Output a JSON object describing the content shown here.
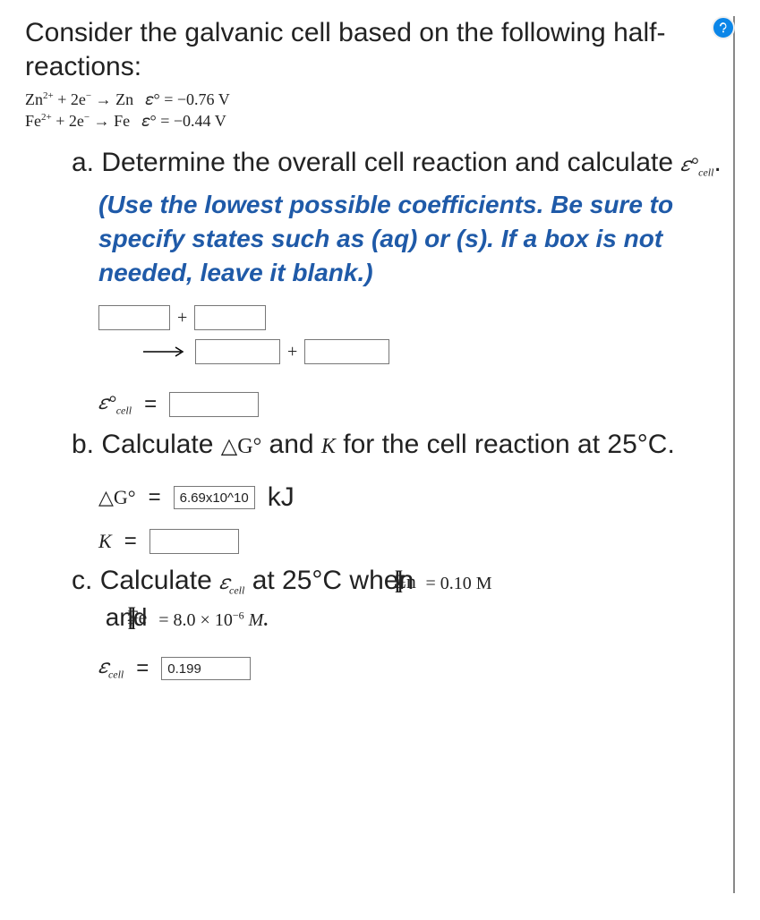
{
  "help": {
    "title": "Help"
  },
  "intro": "Consider the galvanic cell based on the following half-reactions:",
  "halfreactions": {
    "line1_lhs": "Zn",
    "line1_lhs_sup": "2+",
    "line1_e": "+ 2e",
    "line1_e_sup": "−",
    "line1_arrow": "→",
    "line1_rhs": "Zn",
    "line1_eps": "𝜀° = −0.76 V",
    "line2_lhs": "Fe",
    "line2_lhs_sup": "2+",
    "line2_e": "+ 2e",
    "line2_e_sup": "−",
    "line2_arrow": "→",
    "line2_rhs": "Fe",
    "line2_eps": "𝜀° = −0.44 V"
  },
  "partA": {
    "letter": "a.",
    "text1": "Determine the overall cell reaction and calculate ",
    "eps_label": "𝜀°",
    "eps_sub": "cell",
    "period": ".",
    "hint": "(Use the lowest possible coefficients. Be sure to specify states such as (aq) or (s). If a box is not needed, leave it blank.)",
    "plus": "+",
    "ecell_label": "𝜀°",
    "ecell_sub": "cell",
    "equals": "="
  },
  "partB": {
    "letter": "b.",
    "text": "Calculate ",
    "dg": "△G°",
    "and": " and ",
    "K": "K",
    "tail": " for the cell reaction at 25°C.",
    "dg_label": "△G°",
    "equals": "=",
    "dg_value": "6.69x10^10",
    "kj": "kJ",
    "K_label": "K",
    "K_value": ""
  },
  "partC": {
    "letter": "c.",
    "text1": "Calculate ",
    "eps": "𝜀",
    "eps_sub": "cell",
    "text2": " at 25°C when ",
    "zn": "Zn",
    "zn_sup": "2+",
    "zn_val": " = 0.10 M",
    "and": "and ",
    "fe": "Fe",
    "fe_sup": "2+",
    "fe_val": " = 8.0 × 10",
    "fe_exp": "−6",
    "fe_unit": " M",
    "period": ".",
    "ecell_label": "𝜀",
    "ecell_sub": "cell",
    "equals": "=",
    "ecell_value": "0.199"
  }
}
